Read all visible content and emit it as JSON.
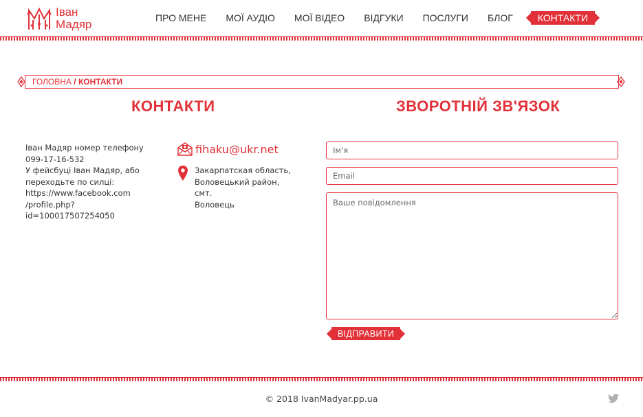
{
  "brand": {
    "line1": "Іван",
    "line2": "Мадяр"
  },
  "nav": {
    "items": [
      {
        "label": "ПРО МЕНЕ"
      },
      {
        "label": "МОЇ АУДІО"
      },
      {
        "label": "МОЇ ВІДЕО"
      },
      {
        "label": "ВІДГУКИ"
      },
      {
        "label": "ПОСЛУГИ"
      },
      {
        "label": "БЛОГ"
      },
      {
        "label": "КОНТАКТИ"
      }
    ],
    "active_index": 6
  },
  "breadcrumb": {
    "home": "ГОЛОВНА",
    "separator": "/",
    "current": "КОНТАКТИ"
  },
  "contacts": {
    "title": "КОНТАКТИ",
    "info_lines": [
      "Іван Мадяр номер телефону",
      "099-17-16-532",
      "У фейсбуці Іван Мадяр, або",
      "переходьте по силці:",
      "https://www.facebook.com",
      "/profile.php?id=100017507254050"
    ],
    "email": "fihaku@ukr.net",
    "address_lines": [
      "Закарпатская область,",
      "Воловецький район, смт.",
      "Воловець"
    ]
  },
  "feedback": {
    "title": "ЗВОРОТНІЙ ЗВ'ЯЗОК",
    "name_placeholder": "Ім'я",
    "email_placeholder": "Email",
    "message_placeholder": "Ваше повідомлення",
    "submit_label": "ВІДПРАВИТИ"
  },
  "footer": {
    "copyright": "© 2018 IvanMadyar.pp.ua"
  },
  "icons": {
    "email": "envelope-icon",
    "address": "map-pin-icon",
    "social": "twitter-icon"
  },
  "colors": {
    "accent": "#e23038",
    "text": "#333333"
  }
}
